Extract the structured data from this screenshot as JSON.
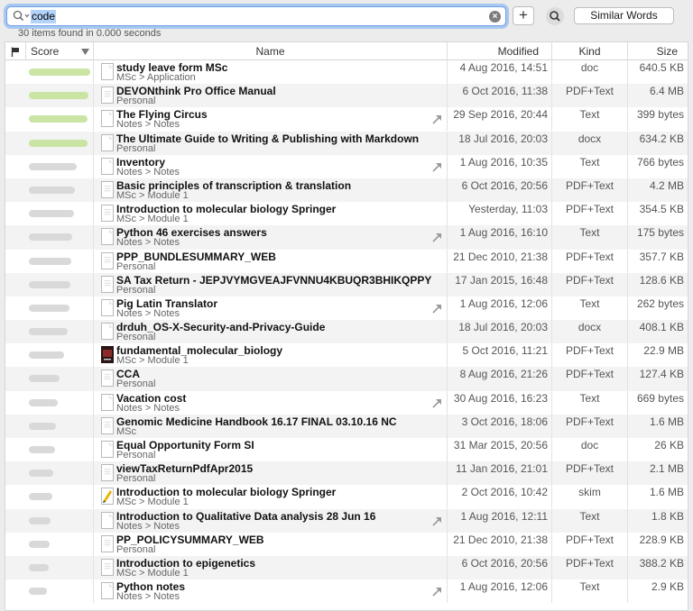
{
  "search": {
    "query": "code",
    "add_label": "+",
    "similar_label": "Similar Words",
    "status": "30 items found in 0.000 seconds"
  },
  "columns": {
    "score": "Score",
    "name": "Name",
    "modified": "Modified",
    "kind": "Kind",
    "size": "Size"
  },
  "colors": {
    "score_high": "#c9e4a3",
    "score_low": "#d9d9d9",
    "focus": "#6ea1e6"
  },
  "rows": [
    {
      "title": "study leave form MSc",
      "path": "MSc > Application",
      "modified": "4 Aug 2016, 14:51",
      "kind": "doc",
      "size": "640.5 KB",
      "score": 1.0,
      "alias": false,
      "icon": "document-icon"
    },
    {
      "title": "DEVONthink Pro Office Manual",
      "path": "Personal",
      "modified": "6 Oct 2016, 11:38",
      "kind": "PDF+Text",
      "size": "6.4 MB",
      "score": 0.97,
      "alias": false,
      "icon": "pdf-icon"
    },
    {
      "title": "The Flying Circus",
      "path": "Notes > Notes",
      "modified": "29 Sep 2016, 20:44",
      "kind": "Text",
      "size": "399 bytes",
      "score": 0.96,
      "alias": true,
      "icon": "document-icon"
    },
    {
      "title": "The Ultimate Guide to Writing & Publishing with Markdown",
      "path": "Personal",
      "modified": "18 Jul 2016, 20:03",
      "kind": "docx",
      "size": "634.2 KB",
      "score": 0.95,
      "alias": false,
      "icon": "document-icon"
    },
    {
      "title": "Inventory",
      "path": "Notes > Notes",
      "modified": "1 Aug 2016, 10:35",
      "kind": "Text",
      "size": "766 bytes",
      "score": 0.78,
      "alias": true,
      "icon": "document-icon"
    },
    {
      "title": "Basic principles of transcription & translation",
      "path": "MSc > Module 1",
      "modified": "6 Oct 2016, 20:56",
      "kind": "PDF+Text",
      "size": "4.2 MB",
      "score": 0.75,
      "alias": false,
      "icon": "pdf-icon"
    },
    {
      "title": "Introduction to molecular biology Springer",
      "path": "MSc > Module 1",
      "modified": "Yesterday, 11:03",
      "kind": "PDF+Text",
      "size": "354.5 KB",
      "score": 0.73,
      "alias": false,
      "icon": "pdf-icon"
    },
    {
      "title": "Python 46 exercises answers",
      "path": "Notes > Notes",
      "modified": "1 Aug 2016, 16:10",
      "kind": "Text",
      "size": "175 bytes",
      "score": 0.71,
      "alias": true,
      "icon": "document-icon"
    },
    {
      "title": "PPP_BUNDLESUMMARY_WEB",
      "path": "Personal",
      "modified": "21 Dec 2010, 21:38",
      "kind": "PDF+Text",
      "size": "357.7 KB",
      "score": 0.69,
      "alias": false,
      "icon": "pdf-icon"
    },
    {
      "title": "SA Tax Return - JEPJVYMGVEAJFVNNU4KBUQR3BHIKQPPY",
      "path": "Personal",
      "modified": "17 Jan 2015, 16:48",
      "kind": "PDF+Text",
      "size": "128.6 KB",
      "score": 0.68,
      "alias": false,
      "icon": "pdf-icon"
    },
    {
      "title": "Pig Latin Translator",
      "path": "Notes > Notes",
      "modified": "1 Aug 2016, 12:06",
      "kind": "Text",
      "size": "262 bytes",
      "score": 0.66,
      "alias": true,
      "icon": "document-icon"
    },
    {
      "title": "drduh_OS-X-Security-and-Privacy-Guide",
      "path": "Personal",
      "modified": "18 Jul 2016, 20:03",
      "kind": "docx",
      "size": "408.1 KB",
      "score": 0.63,
      "alias": false,
      "icon": "document-icon"
    },
    {
      "title": "fundamental_molecular_biology",
      "path": "MSc > Module 1",
      "modified": "5 Oct 2016, 11:21",
      "kind": "PDF+Text",
      "size": "22.9 MB",
      "score": 0.58,
      "alias": false,
      "icon": "book-cover-icon"
    },
    {
      "title": "CCA",
      "path": "Personal",
      "modified": "8 Aug 2016, 21:26",
      "kind": "PDF+Text",
      "size": "127.4 KB",
      "score": 0.5,
      "alias": false,
      "icon": "pdf-icon"
    },
    {
      "title": "Vacation cost",
      "path": "Notes > Notes",
      "modified": "30 Aug 2016, 16:23",
      "kind": "Text",
      "size": "669 bytes",
      "score": 0.47,
      "alias": true,
      "icon": "document-icon"
    },
    {
      "title": "Genomic Medicine Handbook 16.17 FINAL 03.10.16 NC",
      "path": "MSc",
      "modified": "3 Oct 2016, 18:06",
      "kind": "PDF+Text",
      "size": "1.6 MB",
      "score": 0.44,
      "alias": false,
      "icon": "pdf-icon"
    },
    {
      "title": "Equal Opportunity Form SI",
      "path": "Personal",
      "modified": "31 Mar 2015, 20:56",
      "kind": "doc",
      "size": "26 KB",
      "score": 0.42,
      "alias": false,
      "icon": "document-icon"
    },
    {
      "title": "viewTaxReturnPdfApr2015",
      "path": "Personal",
      "modified": "11 Jan 2016, 21:01",
      "kind": "PDF+Text",
      "size": "2.1 MB",
      "score": 0.4,
      "alias": false,
      "icon": "pdf-icon"
    },
    {
      "title": "Introduction to molecular biology Springer",
      "path": "MSc > Module 1",
      "modified": "2 Oct 2016, 10:42",
      "kind": "skim",
      "size": "1.6 MB",
      "score": 0.38,
      "alias": false,
      "icon": "skim-icon"
    },
    {
      "title": "Introduction to Qualitative Data analysis 28 Jun 16",
      "path": "Notes > Notes",
      "modified": "1 Aug 2016, 12:11",
      "kind": "Text",
      "size": "1.8 KB",
      "score": 0.36,
      "alias": true,
      "icon": "document-icon"
    },
    {
      "title": "PP_POLICYSUMMARY_WEB",
      "path": "Personal",
      "modified": "21 Dec 2010, 21:38",
      "kind": "PDF+Text",
      "size": "228.9 KB",
      "score": 0.34,
      "alias": false,
      "icon": "pdf-icon"
    },
    {
      "title": "Introduction to epigenetics",
      "path": "MSc > Module 1",
      "modified": "6 Oct 2016, 20:56",
      "kind": "PDF+Text",
      "size": "388.2 KB",
      "score": 0.32,
      "alias": false,
      "icon": "pdf-icon"
    },
    {
      "title": "Python notes",
      "path": "Notes > Notes",
      "modified": "1 Aug 2016, 12:06",
      "kind": "Text",
      "size": "2.9 KB",
      "score": 0.3,
      "alias": true,
      "icon": "document-icon"
    }
  ]
}
